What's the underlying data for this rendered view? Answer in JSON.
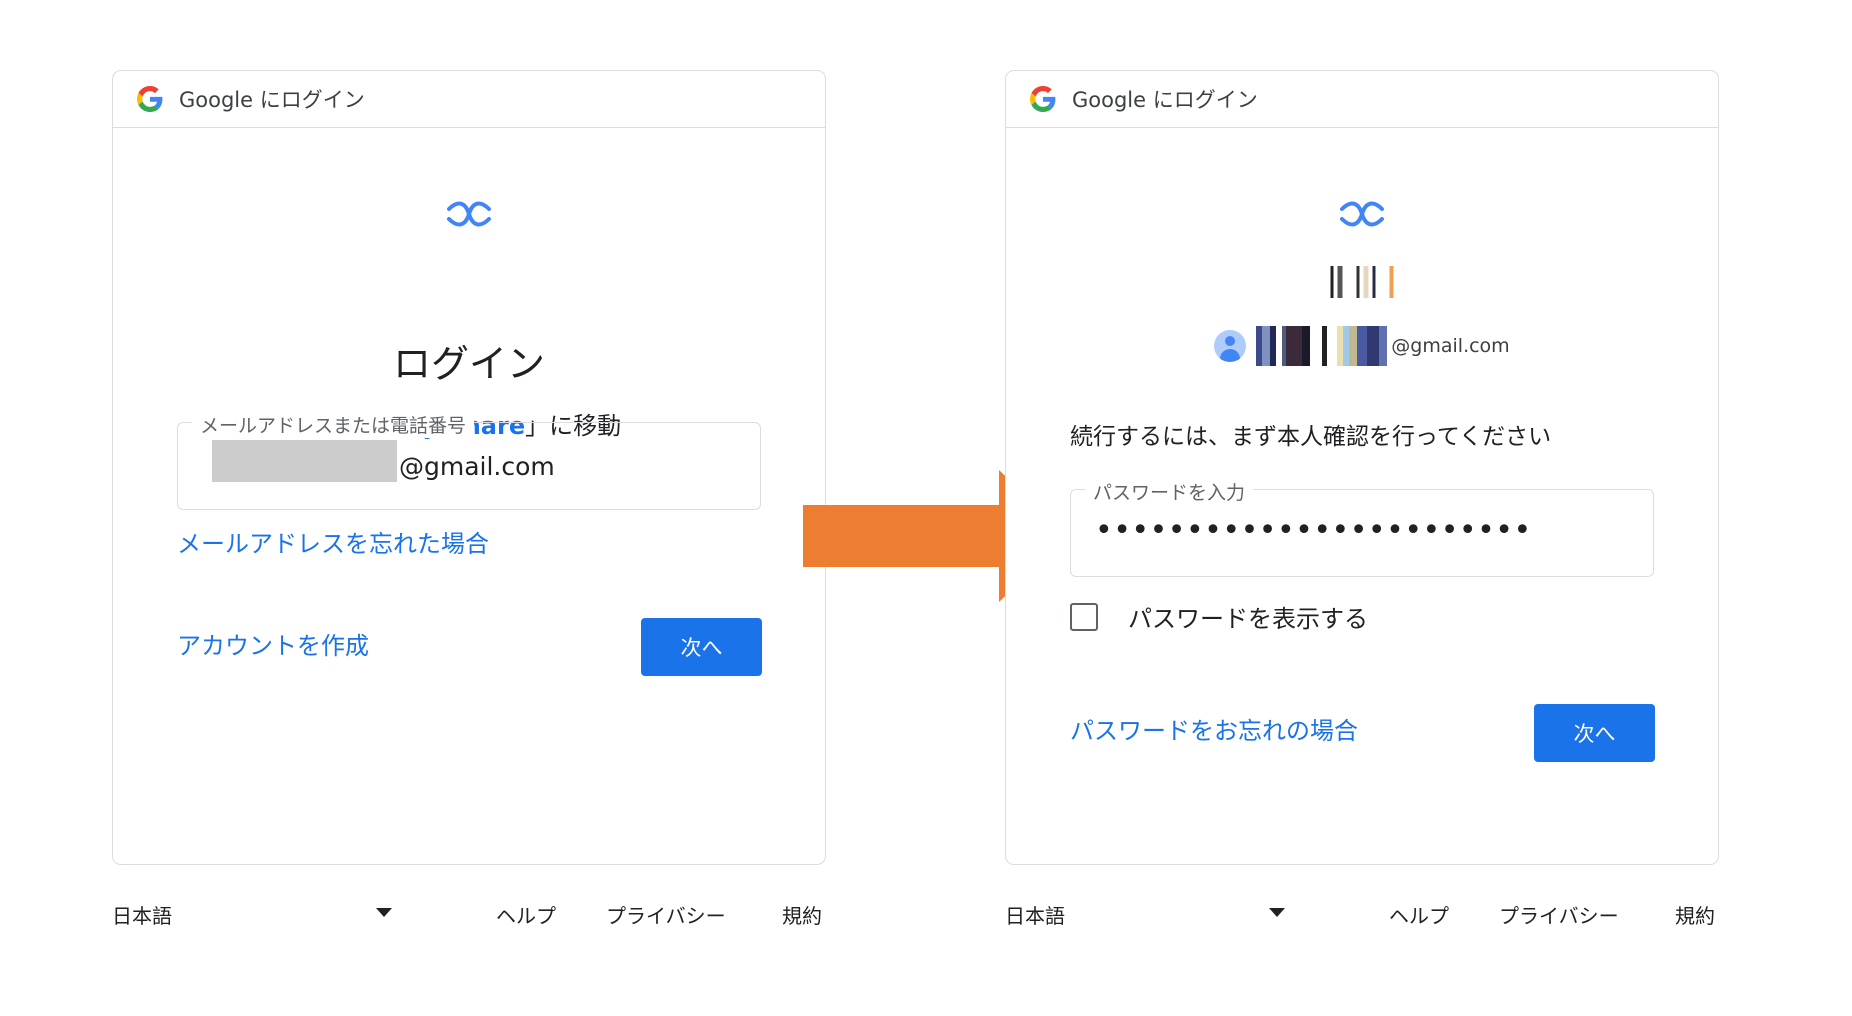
{
  "header_title": "Google にログイン",
  "left": {
    "title": "ログイン",
    "subtitle_open": "「",
    "subtitle_app": "Nearby Share",
    "subtitle_close": "」に移動",
    "email_label": "メールアドレスまたは電話番号",
    "email_suffix": "@gmail.com",
    "forgot_email": "メールアドレスを忘れた場合",
    "create_account": "アカウントを作成",
    "next": "次へ"
  },
  "right": {
    "account_email_suffix": "@gmail.com",
    "verify_text": "続行するには、まず本人確認を行ってください",
    "password_label": "パスワードを入力",
    "password_value": "••••••••••••••••••••••••",
    "show_password": "パスワードを表示する",
    "forgot_password": "パスワードをお忘れの場合",
    "next": "次へ"
  },
  "footer": {
    "language": "日本語",
    "help": "ヘルプ",
    "privacy": "プライバシー",
    "terms": "規約"
  },
  "colors": {
    "accent": "#1a73e8",
    "arrow": "#ed7d31",
    "border": "#dadce0"
  },
  "icons": {
    "google": "google-g-icon",
    "nearby": "nearby-share-icon",
    "arrow": "right-arrow-icon",
    "dropdown": "caret-down-icon"
  }
}
